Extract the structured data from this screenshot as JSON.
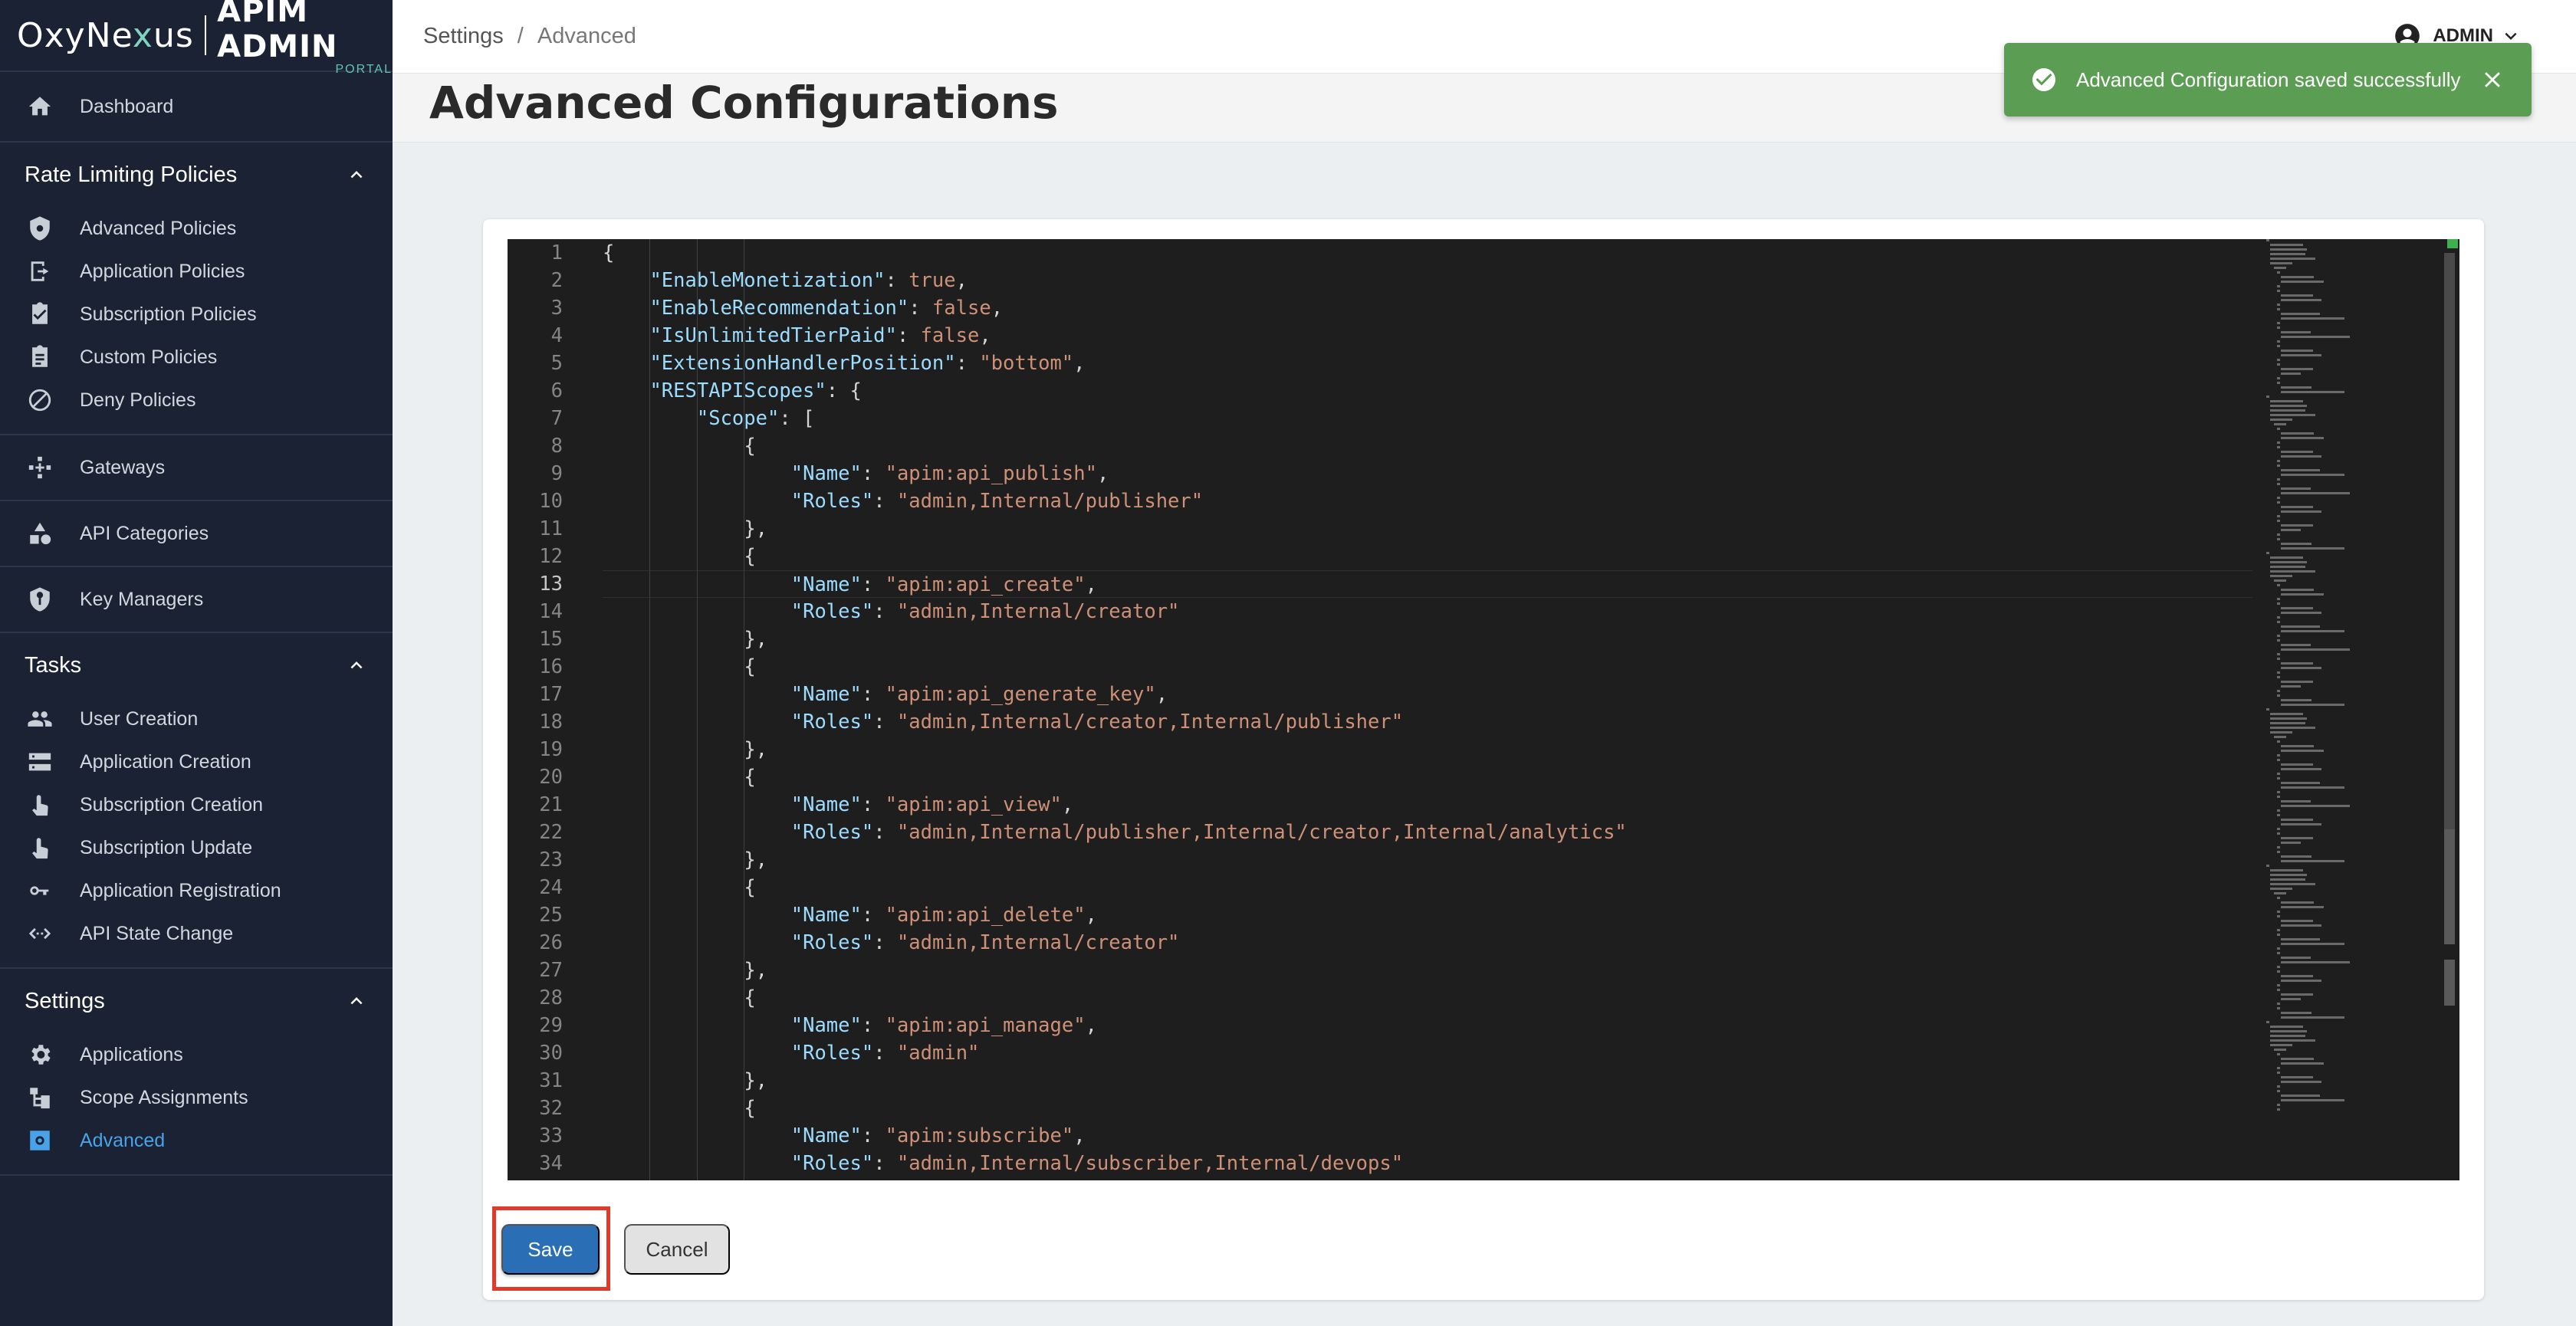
{
  "brand": {
    "name_part1": "OxyNe",
    "name_x": "x",
    "name_part2": "us",
    "title": "APIM ADMIN",
    "subtitle": "PORTAL"
  },
  "sidebar": {
    "dashboard": "Dashboard",
    "rate_limiting": {
      "title": "Rate Limiting Policies",
      "items": [
        "Advanced Policies",
        "Application Policies",
        "Subscription Policies",
        "Custom Policies",
        "Deny Policies"
      ]
    },
    "gateways": "Gateways",
    "api_categories": "API Categories",
    "key_managers": "Key Managers",
    "tasks": {
      "title": "Tasks",
      "items": [
        "User Creation",
        "Application Creation",
        "Subscription Creation",
        "Subscription Update",
        "Application Registration",
        "API State Change"
      ]
    },
    "settings": {
      "title": "Settings",
      "items": [
        "Applications",
        "Scope Assignments",
        "Advanced"
      ]
    },
    "active_item": "Advanced"
  },
  "breadcrumb": {
    "parent": "Settings",
    "separator": "/",
    "current": "Advanced"
  },
  "user": {
    "name": "ADMIN"
  },
  "page": {
    "title": "Advanced Configurations"
  },
  "toast": {
    "message": "Advanced Configuration saved successfully",
    "color": "#5b9e53"
  },
  "editor": {
    "current_line": 13,
    "lines": [
      "{",
      "    \"EnableMonetization\": true,",
      "    \"EnableRecommendation\": false,",
      "    \"IsUnlimitedTierPaid\": false,",
      "    \"ExtensionHandlerPosition\": \"bottom\",",
      "    \"RESTAPIScopes\": {",
      "        \"Scope\": [",
      "            {",
      "                \"Name\": \"apim:api_publish\",",
      "                \"Roles\": \"admin,Internal/publisher\"",
      "            },",
      "            {",
      "                \"Name\": \"apim:api_create\",",
      "                \"Roles\": \"admin,Internal/creator\"",
      "            },",
      "            {",
      "                \"Name\": \"apim:api_generate_key\",",
      "                \"Roles\": \"admin,Internal/creator,Internal/publisher\"",
      "            },",
      "            {",
      "                \"Name\": \"apim:api_view\",",
      "                \"Roles\": \"admin,Internal/publisher,Internal/creator,Internal/analytics\"",
      "            },",
      "            {",
      "                \"Name\": \"apim:api_delete\",",
      "                \"Roles\": \"admin,Internal/creator\"",
      "            },",
      "            {",
      "                \"Name\": \"apim:api_manage\",",
      "                \"Roles\": \"admin\"",
      "            },",
      "            {",
      "                \"Name\": \"apim:subscribe\",",
      "                \"Roles\": \"admin,Internal/subscriber,Internal/devops\""
    ]
  },
  "buttons": {
    "save": "Save",
    "cancel": "Cancel"
  },
  "colors": {
    "sidebar_bg": "#1a2233",
    "active": "#4aa3e8",
    "primary": "#2a6fb5",
    "highlight": "#e03a2a"
  }
}
